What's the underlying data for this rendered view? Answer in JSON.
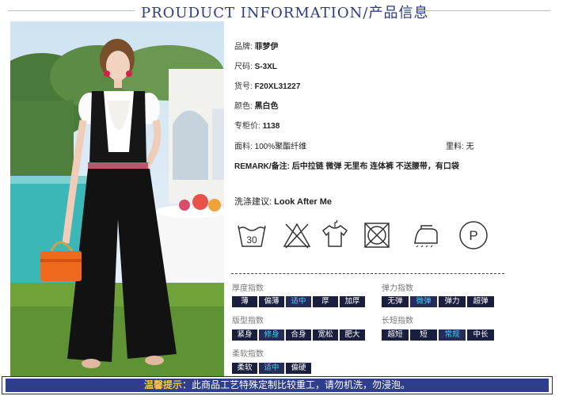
{
  "header": {
    "title": "PROUDUCT INFORMATION/产品信息"
  },
  "info": {
    "brand_label": "品牌:",
    "brand": "菲梦伊",
    "size_label": "尺码:",
    "size": "S-3XL",
    "sku_label": "货号:",
    "sku": "F20XL31227",
    "color_label": "颜色:",
    "color": "黑白色",
    "price_label": "专柜价:",
    "price": "1138",
    "fabric_label": "面料:",
    "fabric": "100%聚酯纤维",
    "lining_label": "里料:",
    "lining": "无",
    "remark_label": "REMARK/备注:",
    "remark": "后中拉链 微弹 无里布 连体裤 不送腰带，有口袋"
  },
  "care": {
    "label": "洗涤建议:",
    "value": "Look After Me",
    "icons": [
      "wash-30-icon",
      "no-bleach-icon",
      "hang-dry-icon",
      "no-tumble-dry-icon",
      "iron-icon",
      "dry-clean-p-icon"
    ],
    "wash_temp": "30",
    "dry_clean_letter": "P"
  },
  "groups": [
    {
      "title": "厚度指数",
      "options": [
        "薄",
        "偏薄",
        "适中",
        "厚",
        "加厚"
      ],
      "selected": 2
    },
    {
      "title": "弹力指数",
      "options": [
        "无弹",
        "微弹",
        "弹力",
        "超弹"
      ],
      "selected": 1
    },
    {
      "title": "版型指数",
      "options": [
        "紧身",
        "修身",
        "合身",
        "宽松",
        "肥大"
      ],
      "selected": 1
    },
    {
      "title": "长短指数",
      "options": [
        "超短",
        "短",
        "常规",
        "中长"
      ],
      "selected": 2
    },
    {
      "title": "柔软指数",
      "options": [
        "柔软",
        "适中",
        "偏硬"
      ],
      "selected": 1
    }
  ],
  "banner": {
    "key": "温馨提示：",
    "text": "此商品工艺特殊定制比较重工，请勿机洗，勿浸泡。"
  },
  "colors": {
    "accent_blue": "#2f3d8e",
    "chip_bg": "#1a1f3f",
    "chip_selected_text": "#3ed0ff",
    "banner_key": "#f5c542"
  }
}
